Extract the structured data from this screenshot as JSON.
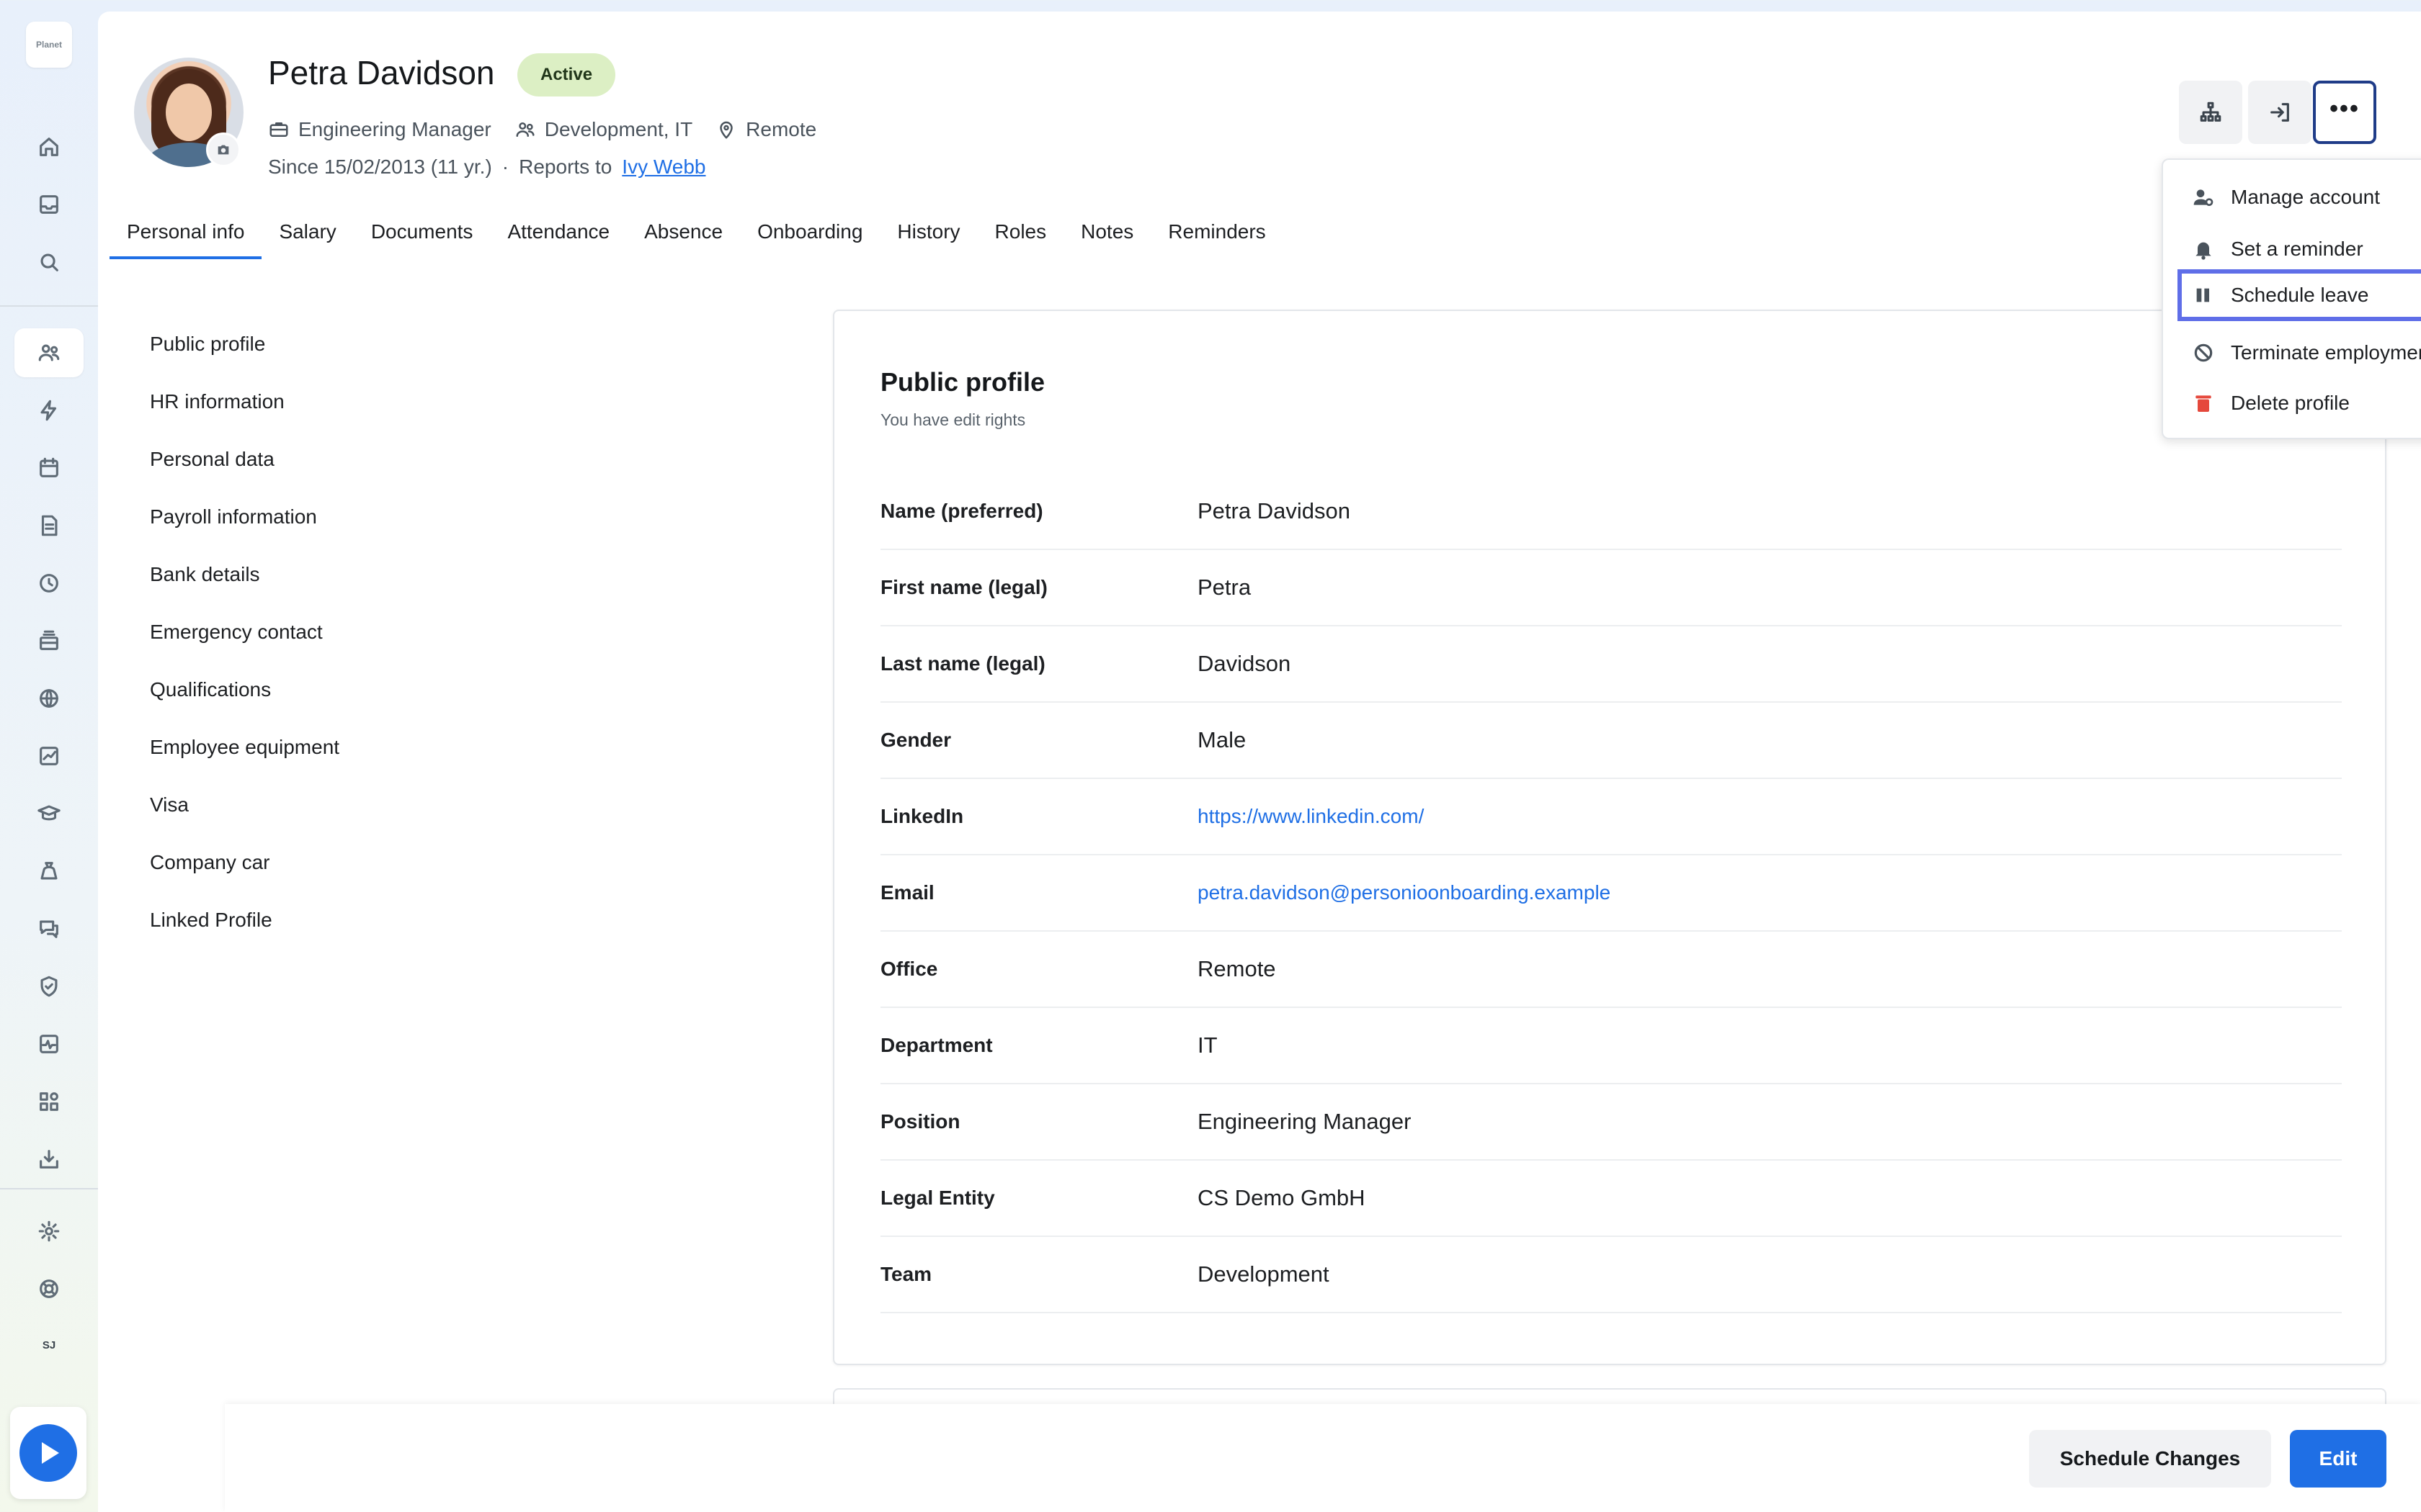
{
  "app": {
    "logo_text": "Planet"
  },
  "rail": {
    "user_initials": "SJ"
  },
  "employee": {
    "name": "Petra Davidson",
    "status": "Active",
    "position": "Engineering Manager",
    "departments": "Development, IT",
    "office": "Remote",
    "since": "Since 15/02/2013 (11 yr.)",
    "separator": "·",
    "reports_to_label": "Reports to",
    "reports_to_name": "Ivy Webb"
  },
  "tabs": [
    {
      "label": "Personal info",
      "active": true
    },
    {
      "label": "Salary"
    },
    {
      "label": "Documents"
    },
    {
      "label": "Attendance"
    },
    {
      "label": "Absence"
    },
    {
      "label": "Onboarding"
    },
    {
      "label": "History"
    },
    {
      "label": "Roles"
    },
    {
      "label": "Notes"
    },
    {
      "label": "Reminders"
    }
  ],
  "sections": [
    "Public profile",
    "HR information",
    "Personal data",
    "Payroll information",
    "Bank details",
    "Emergency contact",
    "Qualifications",
    "Employee equipment",
    "Visa",
    "Company car",
    "Linked Profile"
  ],
  "card": {
    "title": "Public profile",
    "subtitle": "You have edit rights",
    "rows": [
      {
        "label": "Name (preferred)",
        "value": "Petra Davidson"
      },
      {
        "label": "First name (legal)",
        "value": "Petra"
      },
      {
        "label": "Last name (legal)",
        "value": "Davidson"
      },
      {
        "label": "Gender",
        "value": "Male"
      },
      {
        "label": "LinkedIn",
        "value": "https://www.linkedin.com/"
      },
      {
        "label": "Email",
        "value": "petra.davidson@personioonboarding.example"
      },
      {
        "label": "Office",
        "value": "Remote"
      },
      {
        "label": "Department",
        "value": "IT"
      },
      {
        "label": "Position",
        "value": "Engineering Manager"
      },
      {
        "label": "Legal Entity",
        "value": "CS Demo GmbH"
      },
      {
        "label": "Team",
        "value": "Development"
      }
    ]
  },
  "menu": {
    "items": [
      {
        "label": "Manage account",
        "icon": "user-gear-icon"
      },
      {
        "label": "Set a reminder",
        "icon": "bell-icon"
      },
      {
        "label": "Schedule leave",
        "icon": "pause-icon",
        "highlighted": true
      },
      {
        "label": "Terminate employment",
        "icon": "ban-icon"
      },
      {
        "label": "Delete profile",
        "icon": "trash-icon"
      }
    ]
  },
  "actions": {
    "schedule_changes": "Schedule Changes",
    "edit": "Edit"
  },
  "colors": {
    "accent": "#1f6fe5",
    "status_bg": "#dcefc4",
    "highlight_border": "#5f6ee8",
    "delete_icon": "#e5483c"
  }
}
